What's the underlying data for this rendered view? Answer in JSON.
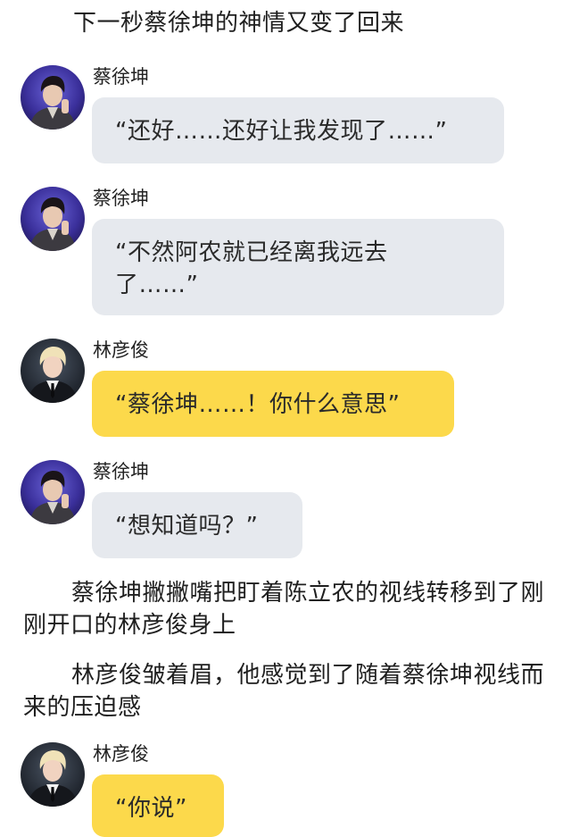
{
  "narration": {
    "top": "下一秒蔡徐坤的神情又变了回来",
    "middle_1": "蔡徐坤撇撇嘴把盯着陈立农的视线转移到了刚刚开口的林彦俊身上",
    "middle_2": "林彦俊皱着眉，他感觉到了随着蔡徐坤视线而来的压迫感"
  },
  "messages": [
    {
      "sender": "蔡徐坤",
      "text": "“还好……还好让我发现了……”",
      "bubble_color": "#e6e9ee",
      "avatar": "cai-xukun-avatar"
    },
    {
      "sender": "蔡徐坤",
      "text": "“不然阿农就已经离我远去了……”",
      "bubble_color": "#e6e9ee",
      "avatar": "cai-xukun-avatar"
    },
    {
      "sender": "林彦俊",
      "text": "“蔡徐坤……！你什么意思”",
      "bubble_color": "#fcd94b",
      "avatar": "lin-yanjun-avatar"
    },
    {
      "sender": "蔡徐坤",
      "text": "“想知道吗？”",
      "bubble_color": "#e6e9ee",
      "avatar": "cai-xukun-avatar"
    },
    {
      "sender": "林彦俊",
      "text": "“你说”",
      "bubble_color": "#fcd94b",
      "avatar": "lin-yanjun-avatar"
    }
  ]
}
